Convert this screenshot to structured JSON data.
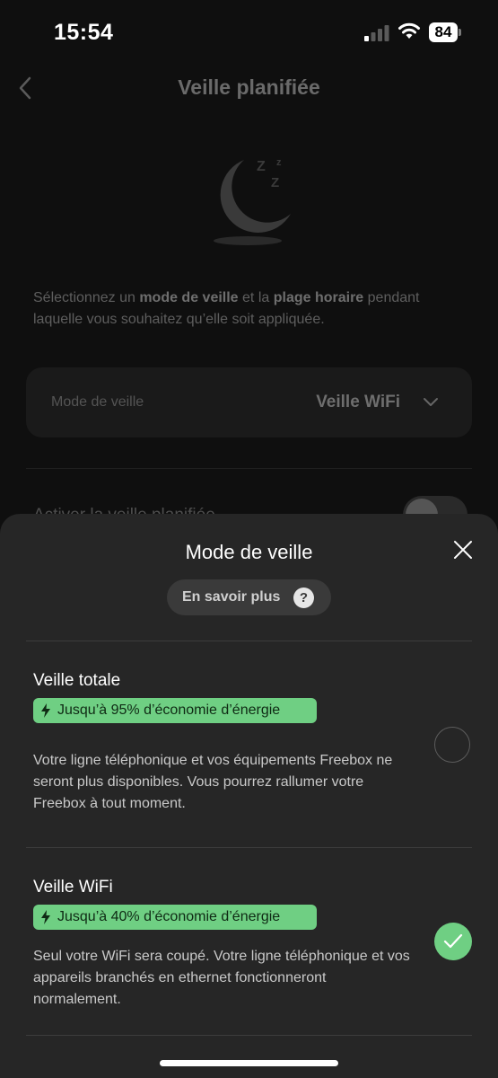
{
  "status_bar": {
    "time": "15:54",
    "battery_level": "84"
  },
  "background_page": {
    "title": "Veille planifiée",
    "intro": {
      "part1": "Sélectionnez un ",
      "bold1": "mode de veille",
      "part2": " et la ",
      "bold2": "plage horaire",
      "part3": " pendant laquelle vous souhaitez qu’elle soit appliquée."
    },
    "mode_card": {
      "label": "Mode de veille",
      "value": "Veille WiFi"
    },
    "activate_label": "Activer la veille planifiée"
  },
  "sheet": {
    "title": "Mode de veille",
    "learn_more_label": "En savoir plus",
    "help_glyph": "?",
    "options": [
      {
        "title": "Veille totale",
        "badge": "Jusqu’à 95% d’économie d’énergie",
        "description": "Votre ligne téléphonique et vos équipements Freebox ne seront plus disponibles. Vous pourrez rallumer votre Freebox à tout moment.",
        "selected": false
      },
      {
        "title": "Veille WiFi",
        "badge": "Jusqu’à 40% d’économie d’énergie",
        "description": "Seul votre WiFi sera coupé. Votre ligne téléphonique et vos appareils branchés en ethernet fonctionneront normalement.",
        "selected": true
      }
    ]
  },
  "colors": {
    "accent_green": "#6fcf83",
    "sheet_background": "#262626"
  },
  "icons": {
    "back": "chevron-left-icon",
    "moon": "moon-sleep-icon",
    "chevron": "chevron-down-icon",
    "close": "close-icon",
    "help": "question-icon",
    "bolt": "lightning-bolt-icon",
    "check": "check-icon"
  }
}
